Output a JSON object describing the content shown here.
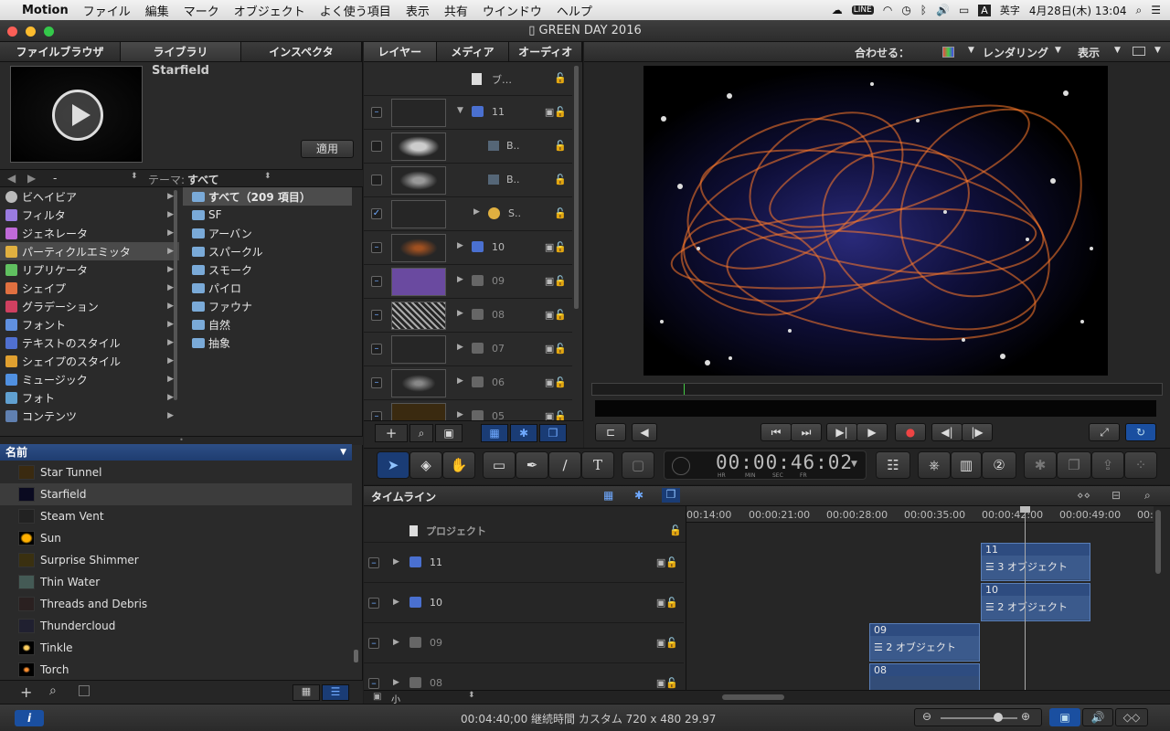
{
  "menubar": {
    "app": "Motion",
    "items": [
      "ファイル",
      "編集",
      "マーク",
      "オブジェクト",
      "よく使う項目",
      "表示",
      "共有",
      "ウインドウ",
      "ヘルプ"
    ],
    "input_mode": "英字",
    "datetime": "4月28日(木) 13:04"
  },
  "window": {
    "title": "GREEN DAY 2016"
  },
  "left_tabs": [
    "ファイルブラウザ",
    "ライブラリ",
    "インスペクタ"
  ],
  "preview": {
    "name": "Starfield",
    "apply_label": "適用"
  },
  "filter": {
    "dash": "-",
    "theme_label": "テーマ:",
    "theme_value": "すべて"
  },
  "categories": [
    "ビヘイビア",
    "フィルタ",
    "ジェネレータ",
    "パーティクルエミッタ",
    "リプリケータ",
    "シェイプ",
    "グラデーション",
    "フォント",
    "テキストのスタイル",
    "シェイプのスタイル",
    "ミュージック",
    "フォト",
    "コンテンツ"
  ],
  "category_colors": [
    "#bbbbbb",
    "#9a7be0",
    "#c06ad8",
    "#e0b040",
    "#60c060",
    "#e07040",
    "#d04060",
    "#6090e0",
    "#5070d0",
    "#e0a030",
    "#5090e0",
    "#60a0d0",
    "#6080b0"
  ],
  "folders": [
    "すべて（209 項目）",
    "SF",
    "アーバン",
    "スパークル",
    "スモーク",
    "パイロ",
    "ファウナ",
    "自然",
    "抽象"
  ],
  "list_header": "名前",
  "items": [
    "Star Tunnel",
    "Starfield",
    "Steam Vent",
    "Sun",
    "Surprise Shimmer",
    "Thin Water",
    "Threads and Debris",
    "Thundercloud",
    "Tinkle",
    "Torch"
  ],
  "layers_tabs": [
    "レイヤー",
    "メディア",
    "オーディオ"
  ],
  "layers": [
    {
      "name": "ブ…",
      "check": ""
    },
    {
      "name": "11",
      "check": "–"
    },
    {
      "name": "B..",
      "check": ""
    },
    {
      "name": "B..",
      "check": ""
    },
    {
      "name": "S..",
      "check": "✓"
    },
    {
      "name": "10",
      "check": "–"
    },
    {
      "name": "09",
      "check": "–"
    },
    {
      "name": "08",
      "check": "–"
    },
    {
      "name": "07",
      "check": "–"
    },
    {
      "name": "06",
      "check": "–"
    },
    {
      "name": "05",
      "check": "–"
    }
  ],
  "canvas_toolbar": {
    "fit_label": "合わせる：",
    "render_label": "レンダリング",
    "view_label": "表示"
  },
  "timecode": {
    "value": "00:00:46:02",
    "units": [
      "HR",
      "MIN",
      "SEC",
      "FR"
    ]
  },
  "timeline": {
    "title": "タイムライン",
    "project_label": "プロジェクト",
    "ruler": [
      "00:14:00",
      "00:00:21:00",
      "00:00:28:00",
      "00:00:35:00",
      "00:00:42:00",
      "00:00:49:00",
      "00:"
    ],
    "tracks": [
      "11",
      "10",
      "09",
      "08"
    ],
    "clips": [
      {
        "title": "11",
        "label": "3 オブジェクト"
      },
      {
        "title": "10",
        "label": "2 オブジェクト"
      },
      {
        "title": "09",
        "label": "2 オブジェクト"
      },
      {
        "title": "08",
        "label": ""
      }
    ],
    "size_label": "小"
  },
  "status": {
    "text": "00:04:40;00 継続時間 カスタム 720 x 480 29.97"
  }
}
